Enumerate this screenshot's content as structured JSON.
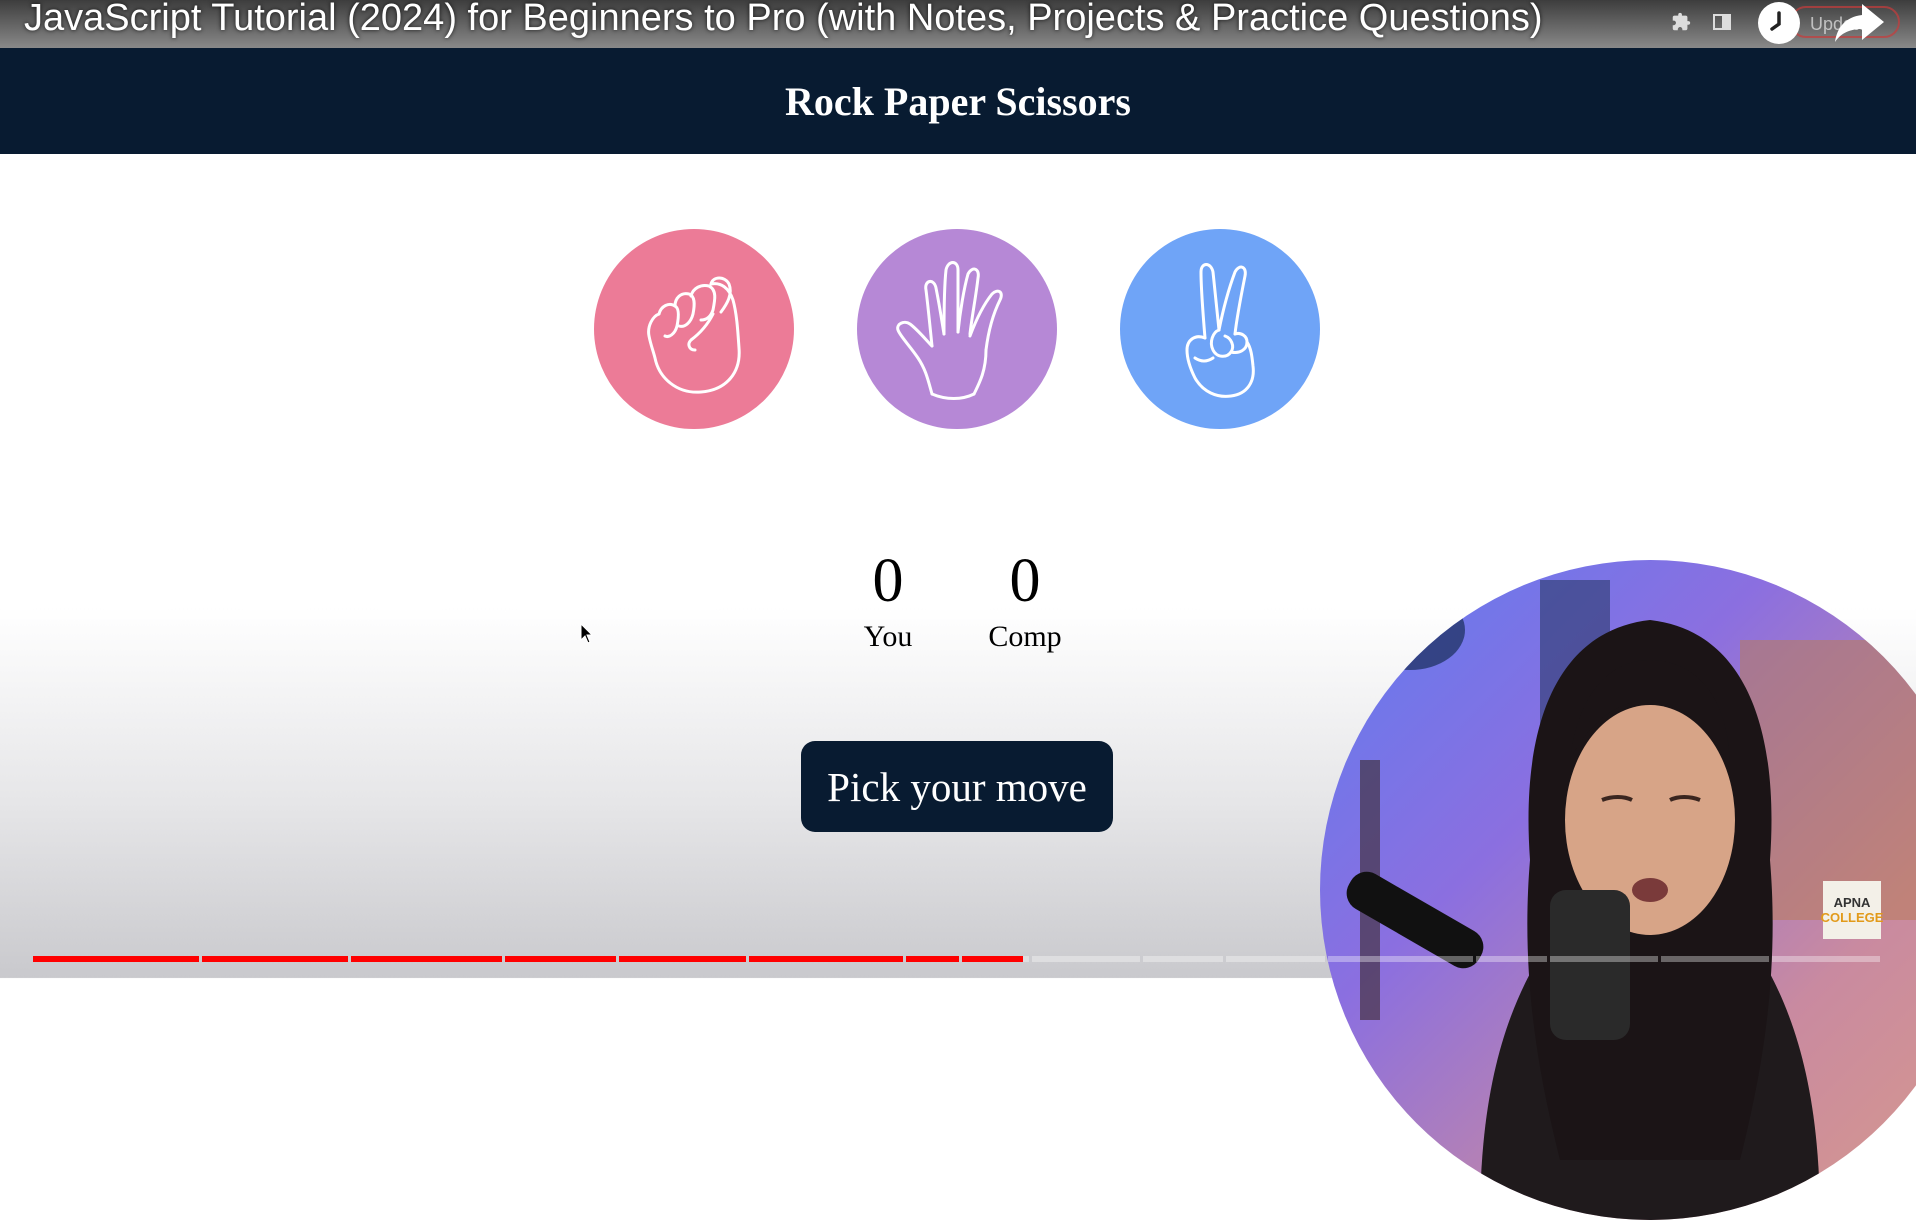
{
  "video": {
    "title": "JavaScript Tutorial (2024) for Beginners to Pro (with Notes, Projects & Practice Questions)",
    "badge_line1": "APNA",
    "badge_line2": "COLLEGE",
    "update_label": "Update",
    "progress_fraction": 0.535
  },
  "app": {
    "title": "Rock Paper Scissors",
    "choices": [
      {
        "id": "rock",
        "icon": "fist-icon",
        "color": "#ec7b97"
      },
      {
        "id": "paper",
        "icon": "open-hand-icon",
        "color": "#b688d6"
      },
      {
        "id": "scissors",
        "icon": "peace-hand-icon",
        "color": "#6fa4f7"
      }
    ],
    "scores": {
      "user_score": "0",
      "user_label": "You",
      "comp_score": "0",
      "comp_label": "Comp"
    },
    "message": "Pick your move",
    "colors": {
      "header_bg": "#081b31",
      "msg_bg": "#081b31"
    }
  },
  "icons": [
    "extensions-icon",
    "sidebar-icon",
    "clock-icon",
    "share-icon",
    "mouse-cursor-icon"
  ]
}
